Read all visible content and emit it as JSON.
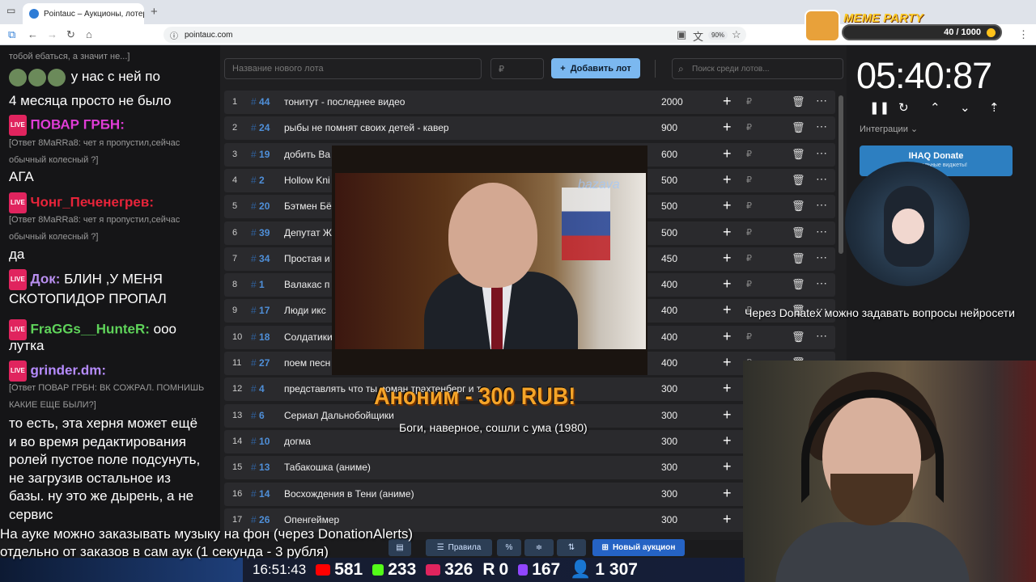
{
  "browser": {
    "tab_title": "Pointauc – Аукционы, лотереи",
    "url": "pointauc.com",
    "zoom": "90%"
  },
  "meme_party": {
    "title": "MEME PARTY",
    "progress": "40 / 1000"
  },
  "chat": {
    "lines": [
      {
        "text": "тобой ебаться, а значит не...]",
        "style": "small"
      },
      {
        "text": "у нас с ней по",
        "style": "big"
      },
      {
        "text": "4 месяца просто не было",
        "style": "big"
      },
      {
        "text": "ПОВАР ГРБН:",
        "style": "name",
        "color": "#e03cd6"
      },
      {
        "text": "[Ответ 8MaRRa8: чет я пропустил,сейчас",
        "style": "small"
      },
      {
        "text": "обычный колесный ?]",
        "style": "small"
      },
      {
        "text": "АГА",
        "style": "big"
      },
      {
        "text": "Чонг_Печенегрев:",
        "style": "name",
        "color": "#e8243a"
      },
      {
        "text": "[Ответ 8MaRRa8: чет я пропустил,сейчас",
        "style": "small"
      },
      {
        "text": "обычный колесный ?]",
        "style": "small"
      },
      {
        "text": "да",
        "style": "big"
      },
      {
        "text": "Док:",
        "style": "name",
        "color": "#b98ff0"
      },
      {
        "text": "БЛИН ,У МЕНЯ",
        "style": "big"
      },
      {
        "text": "СКОТОПИДОР ПРОПАЛ",
        "style": "big"
      },
      {
        "text": "FraGGs__HunteR:",
        "style": "name",
        "color": "#5fd35a"
      },
      {
        "text": "ооо",
        "style": "big"
      },
      {
        "text": "лутка",
        "style": "big"
      },
      {
        "text": "grinder.dm:",
        "style": "name",
        "color": "#b68cff"
      },
      {
        "text": "[Ответ ПОВАР ГРБН: ВК СОЖРАЛ. ПОМНИШЬ",
        "style": "small"
      },
      {
        "text": "КАКИЕ ЕЩЕ БЫЛИ?]",
        "style": "small"
      },
      {
        "text": "то есть, эта херня может ещё",
        "style": "big"
      },
      {
        "text": "и во время редактирования",
        "style": "big"
      },
      {
        "text": "ролей пустое поле подсунуть,",
        "style": "big"
      },
      {
        "text": "не загрузив остальное из",
        "style": "big"
      },
      {
        "text": "базы. ну это же дырень, а не",
        "style": "big"
      },
      {
        "text": "сервис",
        "style": "big"
      }
    ],
    "live_badge": "LIVE"
  },
  "auction": {
    "lot_placeholder": "Название нового лота",
    "amount_placeholder": "₽",
    "add_label": "Добавить лот",
    "search_placeholder": "Поиск среди лотов...",
    "lots": [
      {
        "n": "1",
        "id": "44",
        "name": "тонитут - последнее видео",
        "amount": "2000"
      },
      {
        "n": "2",
        "id": "24",
        "name": "рыбы не помнят своих детей - кавер",
        "amount": "900"
      },
      {
        "n": "3",
        "id": "19",
        "name": "добить Ва",
        "amount": "600"
      },
      {
        "n": "4",
        "id": "2",
        "name": "Hollow Kni",
        "amount": "500"
      },
      {
        "n": "5",
        "id": "20",
        "name": "Бэтмен Бё",
        "amount": "500"
      },
      {
        "n": "6",
        "id": "39",
        "name": "Депутат Ж",
        "amount": "500"
      },
      {
        "n": "7",
        "id": "34",
        "name": "Простая и",
        "amount": "450"
      },
      {
        "n": "8",
        "id": "1",
        "name": "Валакас п",
        "amount": "400"
      },
      {
        "n": "9",
        "id": "17",
        "name": "Люди икс",
        "amount": "400"
      },
      {
        "n": "10",
        "id": "18",
        "name": "Солдатики",
        "amount": "400"
      },
      {
        "n": "11",
        "id": "27",
        "name": "поем песн",
        "amount": "400"
      },
      {
        "n": "12",
        "id": "4",
        "name": "представлять что ты роман трахтенберг и те...",
        "amount": "300"
      },
      {
        "n": "13",
        "id": "6",
        "name": "Сериал Дальнобойщики",
        "amount": "300"
      },
      {
        "n": "14",
        "id": "10",
        "name": "догма",
        "amount": "300"
      },
      {
        "n": "15",
        "id": "13",
        "name": "Табакошка (аниме)",
        "amount": "300"
      },
      {
        "n": "16",
        "id": "14",
        "name": "Восхождения в Тени (аниме)",
        "amount": "300"
      },
      {
        "n": "17",
        "id": "26",
        "name": "Опенгеймер",
        "amount": "300"
      }
    ],
    "currency": "₽",
    "rules_label": "Правила",
    "percent_label": "%",
    "new_auction_label": "Новый аукцион"
  },
  "timer": {
    "value": "05:40:87",
    "integrations_label": "Интеграции",
    "donate_title": "IHAQ Donate",
    "donate_sub": "...уникальные виджеты!"
  },
  "overlay": {
    "alert_name": "Аноним - 300 RUB!",
    "alert_message": "Боги, наверное, сошли с ума (1980)",
    "video_logo": "bazava",
    "cam_caption": "Через Donatex можно задавать вопросы нейросети",
    "ticker_line1": "На ауке можно заказывать музыку на фон (через DonationAlerts)",
    "ticker_line2": "отдельно от заказов в сам аук (1 секунда - 3 рубля)"
  },
  "stats": {
    "time": "16:51:43",
    "youtube": "581",
    "kick": "233",
    "live": "326",
    "rumble": "0",
    "twitch": "167",
    "viewers": "1 307"
  }
}
